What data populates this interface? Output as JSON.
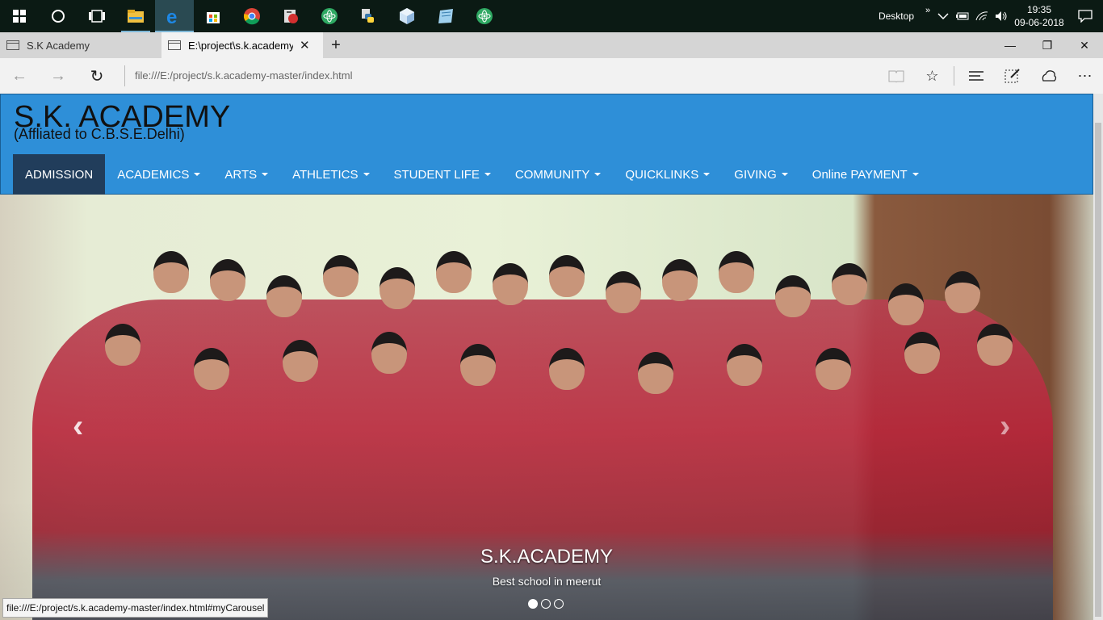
{
  "taskbar": {
    "apps": [
      {
        "name": "start",
        "icon": "windows-start-icon"
      },
      {
        "name": "cortana",
        "icon": "cortana-circle-icon"
      },
      {
        "name": "task-view",
        "icon": "task-view-icon"
      },
      {
        "name": "file-explorer",
        "icon": "folder-icon"
      },
      {
        "name": "edge",
        "icon": "edge-browser-icon"
      },
      {
        "name": "store",
        "icon": "store-icon"
      },
      {
        "name": "chrome",
        "icon": "chrome-icon"
      },
      {
        "name": "media",
        "icon": "media-app-icon"
      },
      {
        "name": "atom-1",
        "icon": "atom-icon"
      },
      {
        "name": "python",
        "icon": "python-icon"
      },
      {
        "name": "3d-builder",
        "icon": "cube-icon"
      },
      {
        "name": "notepad",
        "icon": "notepad-icon"
      },
      {
        "name": "atom-2",
        "icon": "atom-icon"
      }
    ],
    "desktop_label": "Desktop",
    "time": "19:35",
    "date": "09-06-2018"
  },
  "browser": {
    "tabs": [
      {
        "label": "S.K Academy"
      },
      {
        "label": "E:\\project\\s.k.academy-"
      }
    ],
    "url": "file:///E:/project/s.k.academy-master/index.html",
    "status_url": "file:///E:/project/s.k.academy-master/index.html#myCarousel"
  },
  "site": {
    "title": "S.K. ACADEMY",
    "subtitle": "(Affliated to C.B.S.E.Delhi)",
    "nav": [
      {
        "label": "ADMISSION",
        "dropdown": false
      },
      {
        "label": "ACADEMICS",
        "dropdown": true
      },
      {
        "label": "ARTS",
        "dropdown": true
      },
      {
        "label": "ATHLETICS",
        "dropdown": true
      },
      {
        "label": "STUDENT LIFE",
        "dropdown": true
      },
      {
        "label": "COMMUNITY",
        "dropdown": true
      },
      {
        "label": "QUICKLINKS",
        "dropdown": true
      },
      {
        "label": "GIVING",
        "dropdown": true
      },
      {
        "label": "Online PAYMENT",
        "dropdown": true
      }
    ],
    "carousel": {
      "caption_title": "S.K.ACADEMY",
      "caption_text": "Best school in meerut",
      "slides": 3,
      "active_slide": 1,
      "prev_glyph": "‹",
      "next_glyph": "›"
    }
  },
  "colors": {
    "header_bg": "#2e8fd8",
    "nav_active_bg": "#213d5b",
    "taskbar_bg": "#0b1a14"
  }
}
